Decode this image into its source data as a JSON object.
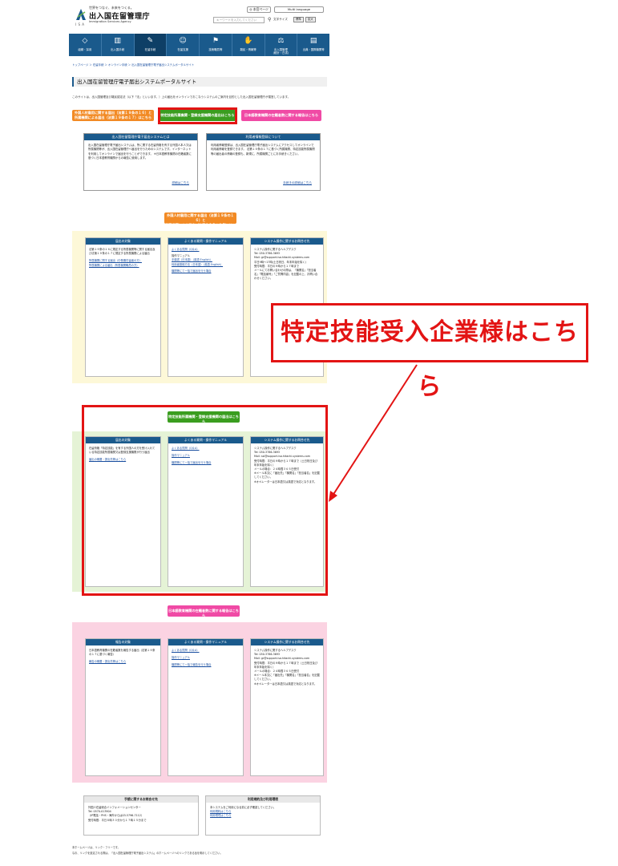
{
  "header": {
    "tagline": "世界をつなぐ、未来をつくる。",
    "agency_name": "出入国在留管理庁",
    "agency_en": "Immigration Services Agency",
    "isa": "I S A",
    "top_button": "◎ 本官ページ",
    "language_button": "Multi language",
    "search_placeholder": "キーワードを入力してください",
    "font_size_label": "文字サイズ",
    "font_size_normal": "標準",
    "font_size_large": "拡大"
  },
  "nav": [
    {
      "icon": "◇",
      "label": "組織・採用"
    },
    {
      "icon": "▥",
      "label": "出入国手続"
    },
    {
      "icon": "✎",
      "label": "在留手続"
    },
    {
      "icon": "☺",
      "label": "在留支援"
    },
    {
      "icon": "⚑",
      "label": "技術職員等"
    },
    {
      "icon": "✋",
      "label": "難民・情報等"
    },
    {
      "icon": "⚖",
      "label": "出入国管理\n(統計・白書)"
    },
    {
      "icon": "▤",
      "label": "出典・国際機関等"
    }
  ],
  "breadcrumb": "トップページ ＞ 在留手続 ＞ オンライン手続 ＞ 出入国在留管理庁電子届出システムポータルサイト",
  "page_title": "出入国在留管理庁電子届出システムポータルサイト",
  "intro_text": "このサイトは、出入国管理及び難民認定法（以下「法」といいます。）上の届出をオンラインでおこなうシステムのご案内を目的とした出入国在留管理庁が運営しています。",
  "buttons": {
    "btn1": "外国人材雇用に関する届出（法第１９条の１６）と\n所属機関による届出（法第１９条の１７）はこちら",
    "btn2": "特定技能所属機関・登録支援機関の届出はこちら",
    "btn3": "日本語教育機関の在籍者数に関する報告はこちら",
    "btn1_repeat": "外国人材雇用に関する届出（法第１９条の１６）と\n所属機関による届出（法第１９条の１７）はこちら",
    "btn2_repeat": "特定技能所属機関・登録支援機関の届出はこちら",
    "btn3_repeat": "日本語教育機関の在籍者数に関する報告はこちら"
  },
  "intro_panels": {
    "left_title": "出入国在留管理庁電子届出システムとは",
    "left_body": "出入国在留管理庁電子届出システムは、所に関する在留資格を有する外国人本人又は所属機関等が、出入国在留管理庁へ届出を行うためのシステムです。インターネットを利用してオンラインで届出を行うことができます。\n※日本語教育機関の在籍者数に基づく日本語教育機関からの報告に使用します。",
    "left_link": "詳細はこちら",
    "right_title": "利用者情報登録について",
    "right_body": "利用者情報登録は、出入国在留管理庁電子届出システムにアクセスしてオンラインで利用者情報を登録できます。\n法第１９条の１７に基づく所属機関、特定技能所属機関等の届出者の情報の登録も、新規に、所属機関ごとにお手続きください。",
    "right_link": "手続きの詳細はこちら"
  },
  "section1": {
    "col1_title": "届出の対象",
    "col1_body": "法第１９条の１６に規定する所属機関等に関する届出及び法第１９条の１７に規定する所属機関による届出",
    "col1_links": [
      "所属機関に関する届出（中長期在留者の方）",
      "所属機関による届出（所属機関職員の方）"
    ],
    "col2_title": "よくある質問・操作マニュアル",
    "col2_links": [
      "よくある質問（Q＆A）",
      "操作マニュアル",
      "手順書（日本語）（英語 English）",
      "利用者登録方法（日本語）（英語 English）",
      "機関等にて一括で届出を行う場合"
    ],
    "col3_title": "システム操作に関するお問合せ先",
    "col3_body": "システム操作に関するヘルプデスク\nTel: 050-3786-3693\nMail: gr@support.isa.hitachi-systems.com\n平日9時〜17時(土日祝日、年末年始を除く)\n受付時間：平日の９時から１７時まで\nメールにてお問い合わせの際は、「機関名」「担当者名」「電話番号」「ご質問内容」を記載の上、お問い合わせください。"
  },
  "section2": {
    "col1_title": "届出の対象",
    "col1_body": "在留資格「特定技能」を有する外国人の方を受け入れている特定技能所属機関又は登録支援機関が行う届出",
    "col1_link": "届出の概要・提出先等はこちら",
    "col2_title": "よくある質問・操作マニュアル",
    "col2_links": [
      "よくある質問（Q＆A）",
      "操作マニュアル",
      "機関等にて一括で届出を行う場合"
    ],
    "col3_title": "システム操作に関するお問合せ先",
    "col3_body": "システム操作に関するヘルプデスク\nTel: 050-3786-3693\nMail: ssl@support.isa.hitachi-systems.com\n受付時間：平日の９時から１７時まで（土日祝日及び年末年始を除く）\nメールの場合：２４時間３６５日受付\n※メール本文に「届出先」「機関名」「担当者名」を記載してください。\n※オペレーターは日本語又は英語で対応となります。"
  },
  "section3": {
    "col1_title": "報告の対象",
    "col1_body": "日本語教育機関の在籍者数を報告する届出（法第１９条の１７に基づく報告）",
    "col1_link": "報告の概要・提出先等はこちら",
    "col2_title": "よくある質問・操作マニュアル",
    "col2_links": [
      "よくある質問（Q＆A）",
      "操作マニュアル",
      "機関等にて一括で報告を行う場合"
    ],
    "col3_title": "システム操作に関するお問合せ先",
    "col3_body": "システム操作に関するヘルプデスク\nTel: 050-3786-3693\nMail: gr@support.isa.hitachi-systems.com\n受付時間：平日の９時から１７時まで（土日祝日及び年末年始を除く）\nメールの場合：２４時間３６５日受付\n※メール本文に「届出先」「機関名」「担当者名」を記載してください。\n※オペレーターは日本語又は英語で対応となります。"
  },
  "footer": {
    "left_title": "手続に関するお問合せ先",
    "left_body": "外国人在留総合インフォメーションセンター\nTel: 0570-013904\n（IP電話・PHS・海外からは03-5796-7112）\n受付時間：平日８時３０分から１７時１５分まで",
    "right_title": "利用規約及び利用環境",
    "right_body": "本システムをご利用になる前に必ず確認してください。",
    "right_links": [
      "利用規約はこちら",
      "利用環境はこちら"
    ],
    "note1": "本ホームページは、リンク・フリーです。",
    "note2": "なお、リンクを設定される際は、「出入国在留管理庁電子届出システム」のホームページへのリンクである旨を明示してください。"
  },
  "callout_text": "特定技能受入企業様はこちら"
}
